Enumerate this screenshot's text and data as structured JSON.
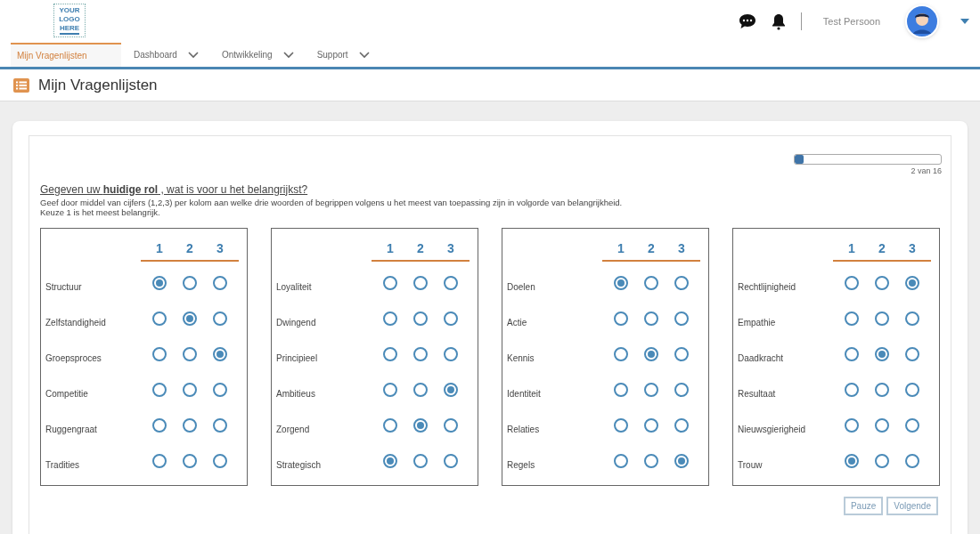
{
  "header": {
    "logo": [
      "YOUR",
      "LOGO",
      "HERE"
    ],
    "user_name": "Test Persoon"
  },
  "nav": [
    {
      "label": "Mijn Vragenlijsten",
      "selected": true,
      "dropdown": false
    },
    {
      "label": "Dashboard",
      "selected": false,
      "dropdown": true
    },
    {
      "label": "Ontwikkeling",
      "selected": false,
      "dropdown": true
    },
    {
      "label": "Support",
      "selected": false,
      "dropdown": true
    }
  ],
  "page_title": "Mijn Vragenlijsten",
  "progress": {
    "level": 0.06,
    "label": "2 van 16"
  },
  "question": {
    "title": "Gegeven uw **huidige rol** , wat is voor u het belangrijkst?",
    "instructions": [
      "Geef door middel van cijfers (1,2,3) per kolom aan welke drie woorden of begrippen volgens u het meest van toepassing zijn in volgorde van belangrijkheid.",
      "Keuze 1 is het meest belangrijk."
    ]
  },
  "groups": [
    {
      "columns": [
        "1",
        "2",
        "3"
      ],
      "rows": [
        {
          "label": "Structuur",
          "choices": [
            {
              "selected": true
            },
            {
              "selected": false
            },
            {
              "selected": false
            }
          ]
        },
        {
          "label": "Zelfstandigheid",
          "choices": [
            {
              "selected": false
            },
            {
              "selected": true
            },
            {
              "selected": false
            }
          ]
        },
        {
          "label": "Groepsproces",
          "choices": [
            {
              "selected": false
            },
            {
              "selected": false
            },
            {
              "selected": true
            }
          ]
        },
        {
          "label": "Competitie",
          "choices": [
            {
              "selected": false
            },
            {
              "selected": false
            },
            {
              "selected": false
            }
          ]
        },
        {
          "label": "Ruggengraat",
          "choices": [
            {
              "selected": false
            },
            {
              "selected": false
            },
            {
              "selected": false
            }
          ]
        },
        {
          "label": "Tradities",
          "choices": [
            {
              "selected": false
            },
            {
              "selected": false
            },
            {
              "selected": false
            }
          ]
        }
      ]
    },
    {
      "columns": [
        "1",
        "2",
        "3"
      ],
      "rows": [
        {
          "label": "Loyaliteit",
          "choices": [
            {
              "selected": false
            },
            {
              "selected": false
            },
            {
              "selected": false
            }
          ]
        },
        {
          "label": "Dwingend",
          "choices": [
            {
              "selected": false
            },
            {
              "selected": false
            },
            {
              "selected": false
            }
          ]
        },
        {
          "label": "Principieel",
          "choices": [
            {
              "selected": false
            },
            {
              "selected": false
            },
            {
              "selected": false
            }
          ]
        },
        {
          "label": "Ambitieus",
          "choices": [
            {
              "selected": false
            },
            {
              "selected": false
            },
            {
              "selected": true
            }
          ]
        },
        {
          "label": "Zorgend",
          "choices": [
            {
              "selected": false
            },
            {
              "selected": true
            },
            {
              "selected": false
            }
          ]
        },
        {
          "label": "Strategisch",
          "choices": [
            {
              "selected": true
            },
            {
              "selected": false
            },
            {
              "selected": false
            }
          ]
        }
      ]
    },
    {
      "columns": [
        "1",
        "2",
        "3"
      ],
      "rows": [
        {
          "label": "Doelen",
          "choices": [
            {
              "selected": true
            },
            {
              "selected": false
            },
            {
              "selected": false
            }
          ]
        },
        {
          "label": "Actie",
          "choices": [
            {
              "selected": false
            },
            {
              "selected": false
            },
            {
              "selected": false
            }
          ]
        },
        {
          "label": "Kennis",
          "choices": [
            {
              "selected": false
            },
            {
              "selected": true
            },
            {
              "selected": false
            }
          ]
        },
        {
          "label": "Identiteit",
          "choices": [
            {
              "selected": false
            },
            {
              "selected": false
            },
            {
              "selected": false
            }
          ]
        },
        {
          "label": "Relaties",
          "choices": [
            {
              "selected": false
            },
            {
              "selected": false
            },
            {
              "selected": false
            }
          ]
        },
        {
          "label": "Regels",
          "choices": [
            {
              "selected": false
            },
            {
              "selected": false
            },
            {
              "selected": true
            }
          ]
        }
      ]
    },
    {
      "columns": [
        "1",
        "2",
        "3"
      ],
      "rows": [
        {
          "label": "Rechtlijnigheid",
          "choices": [
            {
              "selected": false
            },
            {
              "selected": false
            },
            {
              "selected": true
            }
          ]
        },
        {
          "label": "Empathie",
          "choices": [
            {
              "selected": false
            },
            {
              "selected": false
            },
            {
              "selected": false
            }
          ]
        },
        {
          "label": "Daadkracht",
          "choices": [
            {
              "selected": false
            },
            {
              "selected": true
            },
            {
              "selected": false
            }
          ]
        },
        {
          "label": "Resultaat",
          "choices": [
            {
              "selected": false
            },
            {
              "selected": false
            },
            {
              "selected": false
            }
          ]
        },
        {
          "label": "Nieuwsgierigheid",
          "choices": [
            {
              "selected": false
            },
            {
              "selected": false
            },
            {
              "selected": false
            }
          ]
        },
        {
          "label": "Trouw",
          "choices": [
            {
              "selected": true
            },
            {
              "selected": false
            },
            {
              "selected": false
            }
          ]
        }
      ]
    }
  ],
  "buttons": [
    "Pauze",
    "Volgende"
  ]
}
